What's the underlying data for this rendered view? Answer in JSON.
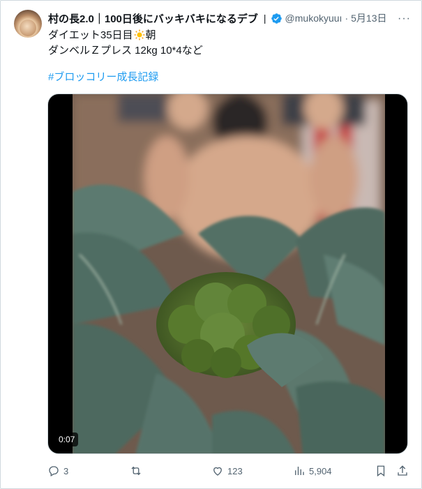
{
  "post": {
    "display_name": "村の長2.0｜100日後にバッキバキになるデブ",
    "separator": "|",
    "handle": "@mukokyuuı",
    "dot": "·",
    "date": "5月13日",
    "more": "···",
    "text_line1_before": "ダイエット35日目",
    "text_line1_after": "朝",
    "text_line2": "ダンベルＺプレス 12kg 10*4など",
    "hashtag": "#ブロッコリー成長記録"
  },
  "media": {
    "duration": "0:07"
  },
  "actions": {
    "reply_count": "3",
    "retweet_count": "",
    "like_count": "123",
    "views_count": "5,904"
  },
  "colors": {
    "accent": "#1d9bf0",
    "text": "#0f1419",
    "secondary": "#536471",
    "border": "#cfd9de"
  },
  "icons": [
    "verified-badge-icon",
    "sun-icon",
    "reply-icon",
    "retweet-icon",
    "like-icon",
    "views-icon",
    "bookmark-icon",
    "share-icon"
  ]
}
